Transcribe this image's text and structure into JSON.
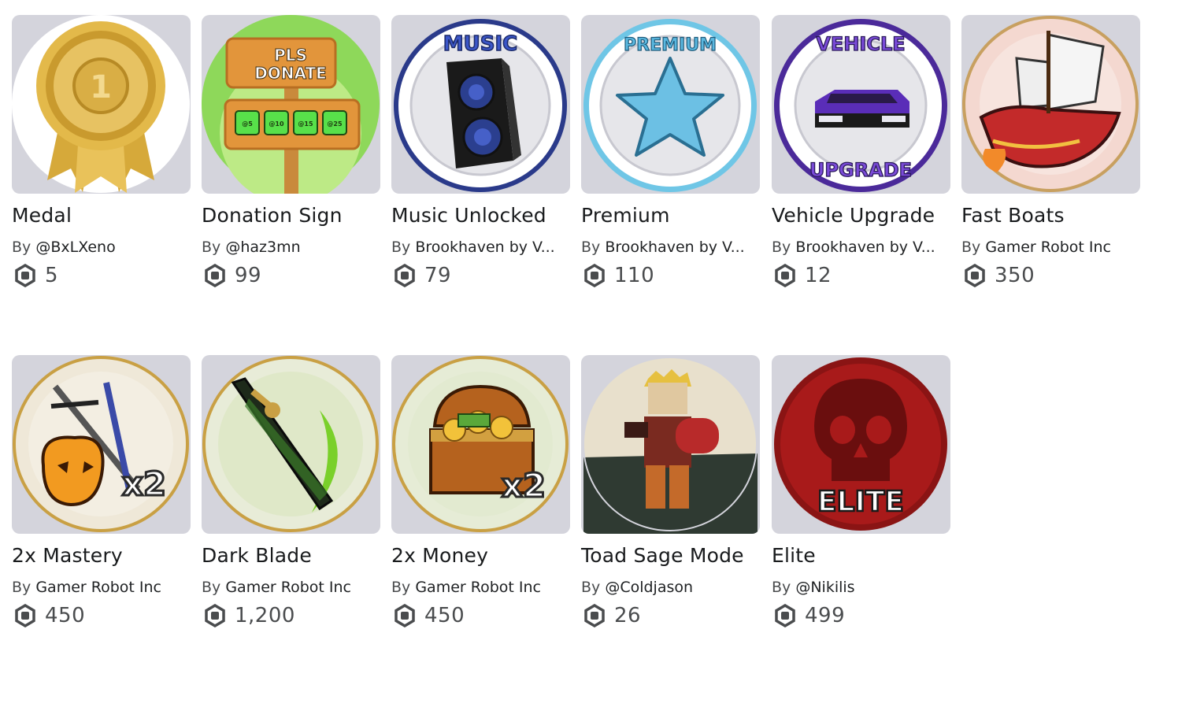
{
  "currency_icon": "robux-icon",
  "colors": {
    "thumb_bg": "#d4d4dc",
    "title": "#191b1d",
    "meta": "#393b3d",
    "price": "#4a4c4e"
  },
  "items": [
    {
      "title": "Medal",
      "by": "By",
      "creator": "@BxLXeno",
      "price": "5",
      "icon": "gold-medal-icon"
    },
    {
      "title": "Donation Sign",
      "by": "By",
      "creator": "@haz3mn",
      "price": "99",
      "icon": "donation-sign-icon",
      "sign_line1": "PLS",
      "sign_line2": "DONATE",
      "sign_amounts": [
        "@5",
        "@10",
        "@15",
        "@25"
      ]
    },
    {
      "title": "Music Unlocked",
      "by": "By",
      "creator": "Brookhaven by V...",
      "price": "79",
      "icon": "speaker-icon",
      "badge_text": "MUSIC"
    },
    {
      "title": "Premium",
      "by": "By",
      "creator": "Brookhaven by V...",
      "price": "110",
      "icon": "star-icon",
      "badge_text": "PREMIUM"
    },
    {
      "title": "Vehicle Upgrade",
      "by": "By",
      "creator": "Brookhaven by V...",
      "price": "12",
      "icon": "car-icon",
      "badge_text_top": "VEHICLE",
      "badge_text_bottom": "UPGRADE"
    },
    {
      "title": "Fast Boats",
      "by": "By",
      "creator": "Gamer Robot Inc",
      "price": "350",
      "icon": "ship-icon"
    },
    {
      "title": "2x Mastery",
      "by": "By",
      "creator": "Gamer Robot Inc",
      "price": "450",
      "icon": "swords-icon",
      "badge_text": "x2"
    },
    {
      "title": "Dark Blade",
      "by": "By",
      "creator": "Gamer Robot Inc",
      "price": "1,200",
      "icon": "dark-blade-icon"
    },
    {
      "title": "2x Money",
      "by": "By",
      "creator": "Gamer Robot Inc",
      "price": "450",
      "icon": "treasure-chest-icon",
      "badge_text": "x2"
    },
    {
      "title": "Toad Sage Mode",
      "by": "By",
      "creator": "@Coldjason",
      "price": "26",
      "icon": "avatar-character-icon"
    },
    {
      "title": "Elite",
      "by": "By",
      "creator": "@Nikilis",
      "price": "499",
      "icon": "skull-icon",
      "badge_text": "ELITE"
    }
  ]
}
